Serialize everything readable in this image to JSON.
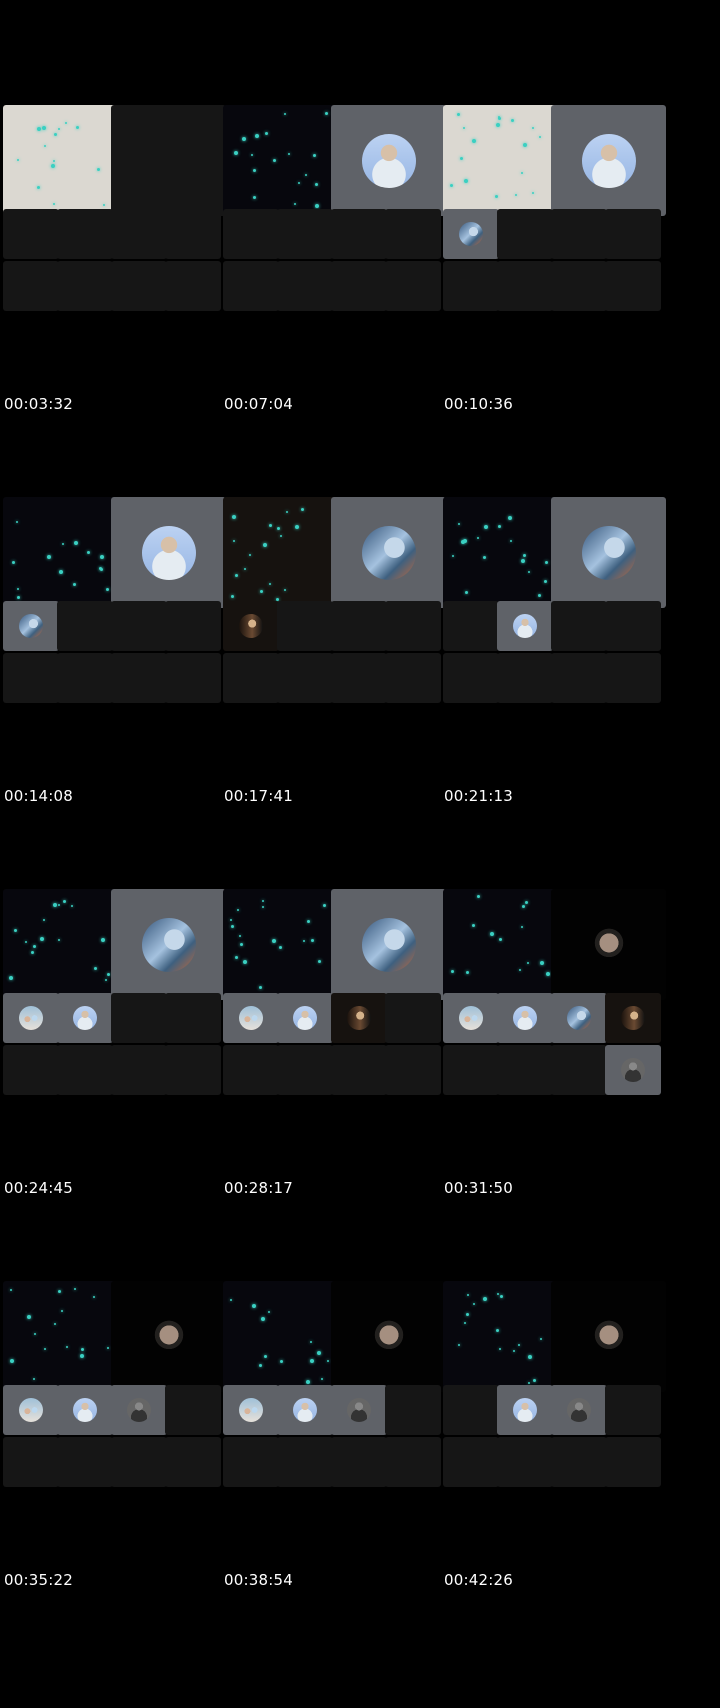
{
  "timestamps": [
    "00:03:32",
    "00:07:04",
    "00:10:36",
    "00:14:08",
    "00:17:41",
    "00:21:13",
    "00:24:45",
    "00:28:17",
    "00:31:50",
    "00:35:22",
    "00:38:54",
    "00:42:26"
  ],
  "colors": {
    "background": "#000000",
    "tile_empty": "#161616",
    "tile_gray": "#5f6268",
    "particle": "#3ad0c2"
  },
  "frames": [
    {
      "large": [
        "cream-particles",
        "empty"
      ],
      "small": [
        "",
        "",
        "",
        "",
        "",
        "",
        "",
        ""
      ]
    },
    {
      "large": [
        "dark-particles",
        "avatar-man"
      ],
      "small": [
        "",
        "",
        "",
        "",
        "",
        "",
        "",
        ""
      ]
    },
    {
      "large": [
        "cream-particles",
        "avatar-man"
      ],
      "small": [
        "avatar-blue",
        "",
        "",
        "",
        "",
        "",
        "",
        ""
      ]
    },
    {
      "large": [
        "dark-particles",
        "avatar-man"
      ],
      "small": [
        "avatar-blue",
        "",
        "",
        "",
        "",
        "",
        "",
        ""
      ]
    },
    {
      "large": [
        "warm-particles",
        "avatar-blue"
      ],
      "small": [
        "avatar-hair",
        "",
        "",
        "",
        "",
        "",
        "",
        ""
      ]
    },
    {
      "large": [
        "dark-particles",
        "avatar-blue"
      ],
      "small": [
        "",
        "avatar-man",
        "",
        "",
        "",
        "",
        "",
        ""
      ]
    },
    {
      "large": [
        "dark-particles",
        "avatar-blue"
      ],
      "small": [
        "avatar-group",
        "avatar-man",
        "",
        "",
        "",
        "",
        "",
        ""
      ]
    },
    {
      "large": [
        "dark-particles",
        "avatar-blue"
      ],
      "small": [
        "avatar-group",
        "avatar-man",
        "avatar-hair",
        "",
        "",
        "",
        "",
        ""
      ]
    },
    {
      "large": [
        "dark-particles",
        "face-dark"
      ],
      "small": [
        "avatar-group",
        "avatar-man",
        "avatar-blue",
        "avatar-hair",
        "",
        "",
        "",
        "avatar-bw"
      ]
    },
    {
      "large": [
        "dark-particles",
        "face-dark"
      ],
      "small": [
        "avatar-group",
        "avatar-man",
        "avatar-bw",
        "",
        "",
        "",
        "",
        ""
      ]
    },
    {
      "large": [
        "dark-particles",
        "face-dark"
      ],
      "small": [
        "avatar-group",
        "avatar-man",
        "avatar-bw",
        "",
        "",
        "",
        "",
        ""
      ]
    },
    {
      "large": [
        "dark-particles",
        "face-dark"
      ],
      "small": [
        "",
        "avatar-man",
        "avatar-bw",
        "",
        "",
        "",
        "",
        ""
      ]
    }
  ]
}
